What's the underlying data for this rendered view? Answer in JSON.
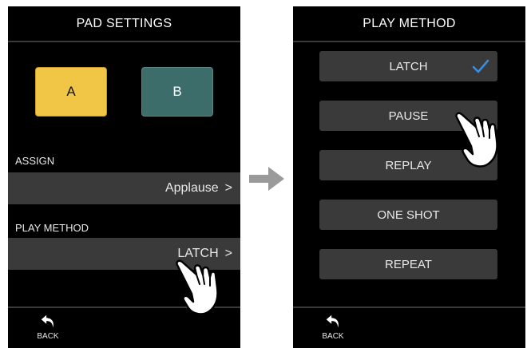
{
  "left_screen": {
    "title": "PAD SETTINGS",
    "pads": [
      {
        "label": "A",
        "color": "#f1c646"
      },
      {
        "label": "B",
        "color": "#3d6d6b"
      }
    ],
    "assign": {
      "label": "ASSIGN",
      "value": "Applause",
      "chevron": ">"
    },
    "play_method": {
      "label": "PLAY METHOD",
      "value": "LATCH",
      "chevron": ">"
    },
    "back_label": "BACK"
  },
  "right_screen": {
    "title": "PLAY METHOD",
    "options": [
      {
        "label": "LATCH",
        "selected": true
      },
      {
        "label": "PAUSE",
        "selected": false
      },
      {
        "label": "REPLAY",
        "selected": false
      },
      {
        "label": "ONE SHOT",
        "selected": false
      },
      {
        "label": "REPEAT",
        "selected": false
      }
    ],
    "back_label": "BACK"
  },
  "colors": {
    "screen_bg": "#000000",
    "row_bg": "#3a3a3a",
    "check_accent": "#3a8ee0",
    "arrow": "#9a9a9a"
  },
  "icons": {
    "back": "back-arrow-icon",
    "check": "checkmark-icon",
    "transition": "right-arrow-icon",
    "touch": "pointing-hand-icon"
  }
}
